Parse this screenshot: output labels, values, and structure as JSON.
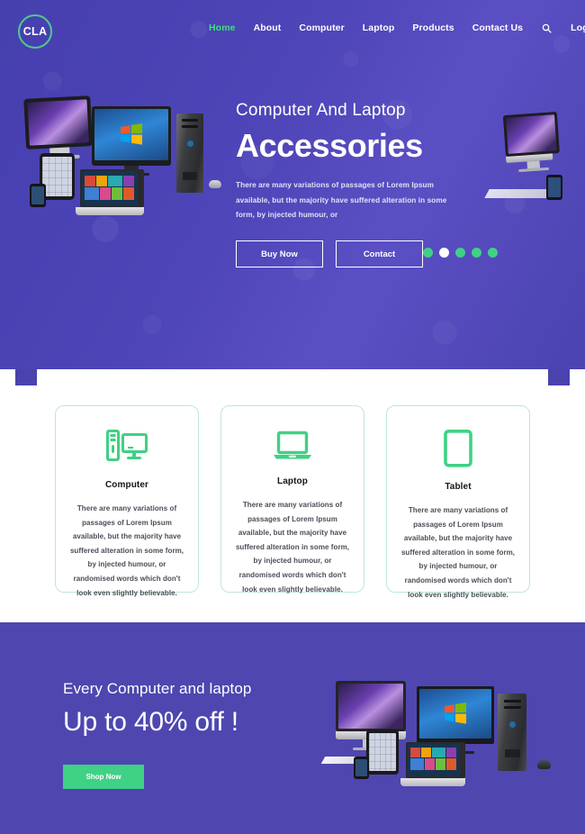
{
  "site": {
    "logo_text": "CLA",
    "accent_green": "#3fd185",
    "accent_purple": "#4a42ad",
    "logo_ring_color": "#4ecb8d"
  },
  "nav": {
    "items": [
      {
        "label": "Home",
        "active": true
      },
      {
        "label": "About",
        "active": false
      },
      {
        "label": "Computer",
        "active": false
      },
      {
        "label": "Laptop",
        "active": false
      },
      {
        "label": "Products",
        "active": false
      },
      {
        "label": "Contact Us",
        "active": false
      }
    ],
    "search_icon": "search-icon",
    "login_label": "Login"
  },
  "hero": {
    "subtitle": "Computer And Laptop",
    "title": "Accessories",
    "paragraph": "There are many variations of passages of Lorem Ipsum available, but the majority have suffered alteration in some form, by injected humour, or",
    "primary_button": "Buy Now",
    "secondary_button": "Contact",
    "carousel": {
      "count": 5,
      "active_index": 1
    },
    "image_left_alt": "computer-laptop-tablet-phone-cluster",
    "image_right_alt": "imac-keyboard-phone"
  },
  "cards": [
    {
      "icon": "desktop-computer-icon",
      "title": "Computer",
      "text": "There are many variations of passages of Lorem Ipsum available, but the majority have suffered alteration in some form, by injected humour, or randomised words which don't look even slightly believable."
    },
    {
      "icon": "laptop-icon",
      "title": "Laptop",
      "text": "There are many variations of passages of Lorem Ipsum available, but the majority have suffered alteration in some form, by injected humour, or randomised words which don't look even slightly believable."
    },
    {
      "icon": "tablet-icon",
      "title": "Tablet",
      "text": "There are many variations of passages of Lorem Ipsum available, but the majority have suffered alteration in some form, by injected humour, or randomised words which don't look even slightly believable."
    }
  ],
  "promo": {
    "subtitle": "Every Computer and laptop",
    "title": "Up to 40% off !",
    "button_label": "Shop Now",
    "image_alt": "imac-monitor-tower-laptop-tablet-phone-cluster"
  }
}
